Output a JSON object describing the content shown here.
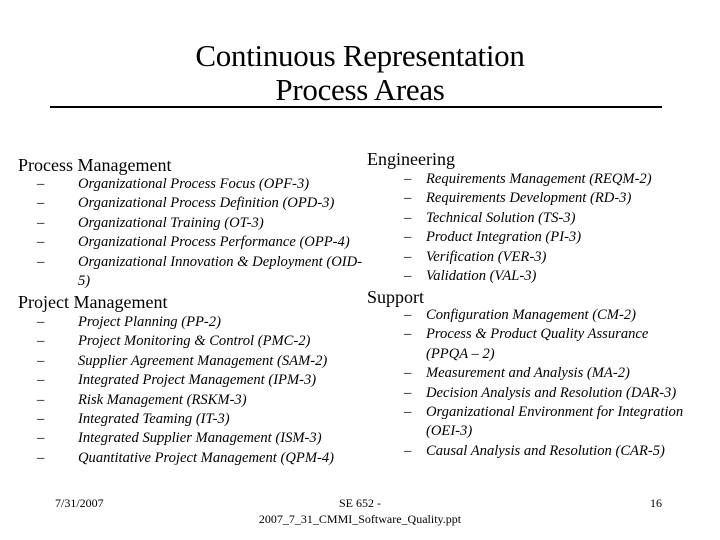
{
  "slide": {
    "title_line1": "Continuous Representation",
    "title_line2": "Process Areas"
  },
  "process_management": {
    "heading": "Process Management",
    "items": [
      {
        "dash": "–",
        "lines": [
          "Organizational Process Focus (OPF-3)"
        ]
      },
      {
        "dash": "–",
        "lines": [
          "Organizational Process Definition (OPD-3)"
        ]
      },
      {
        "dash": "–",
        "lines": [
          "Organizational Training (OT-3)"
        ]
      },
      {
        "dash": "–",
        "lines": [
          "Organizational Process Performance (OPP-4)"
        ]
      },
      {
        "dash": "–",
        "lines": [
          "Organizational Innovation & Deployment (OID-",
          "5)"
        ]
      }
    ]
  },
  "project_management": {
    "heading": "Project Management",
    "items": [
      {
        "dash": "–",
        "lines": [
          "Project Planning (PP-2)"
        ]
      },
      {
        "dash": "–",
        "lines": [
          "Project Monitoring & Control (PMC-2)"
        ]
      },
      {
        "dash": "–",
        "lines": [
          "Supplier Agreement Management (SAM-2)"
        ]
      },
      {
        "dash": "–",
        "lines": [
          "Integrated Project Management (IPM-3)"
        ]
      },
      {
        "dash": "–",
        "lines": [
          "Risk Management (RSKM-3)"
        ]
      },
      {
        "dash": "–",
        "lines": [
          "Integrated Teaming (IT-3)"
        ]
      },
      {
        "dash": "–",
        "lines": [
          "Integrated Supplier Management (ISM-3)"
        ]
      },
      {
        "dash": "–",
        "lines": [
          "Quantitative Project Management (QPM-4)"
        ]
      }
    ]
  },
  "engineering": {
    "heading": "Engineering",
    "items": [
      {
        "dash": "–",
        "lines": [
          "Requirements Management (REQM-2)"
        ]
      },
      {
        "dash": "–",
        "lines": [
          "Requirements Development (RD-3)"
        ]
      },
      {
        "dash": "–",
        "lines": [
          "Technical Solution (TS-3)"
        ]
      },
      {
        "dash": "–",
        "lines": [
          "Product Integration (PI-3)"
        ]
      },
      {
        "dash": "–",
        "lines": [
          "Verification (VER-3)"
        ]
      },
      {
        "dash": "–",
        "lines": [
          "Validation (VAL-3)"
        ]
      }
    ]
  },
  "support": {
    "heading": "Support",
    "items": [
      {
        "dash": "–",
        "lines": [
          "Configuration Management (CM-2)"
        ]
      },
      {
        "dash": "–",
        "lines": [
          "Process & Product Quality Assurance",
          "(PPQA – 2)"
        ]
      },
      {
        "dash": "–",
        "lines": [
          "Measurement and Analysis (MA-2)"
        ]
      },
      {
        "dash": "–",
        "lines": [
          "Decision Analysis and Resolution (DAR-3)"
        ]
      },
      {
        "dash": "–",
        "lines": [
          "Organizational Environment for Integration",
          "(OEI-3)"
        ]
      },
      {
        "dash": "–",
        "lines": [
          "Causal Analysis and Resolution (CAR-5)"
        ]
      }
    ]
  },
  "footer": {
    "date": "7/31/2007",
    "center_line1": "SE 652 -",
    "center_line2": "2007_7_31_CMMI_Software_Quality.ppt",
    "page_number": "16"
  }
}
